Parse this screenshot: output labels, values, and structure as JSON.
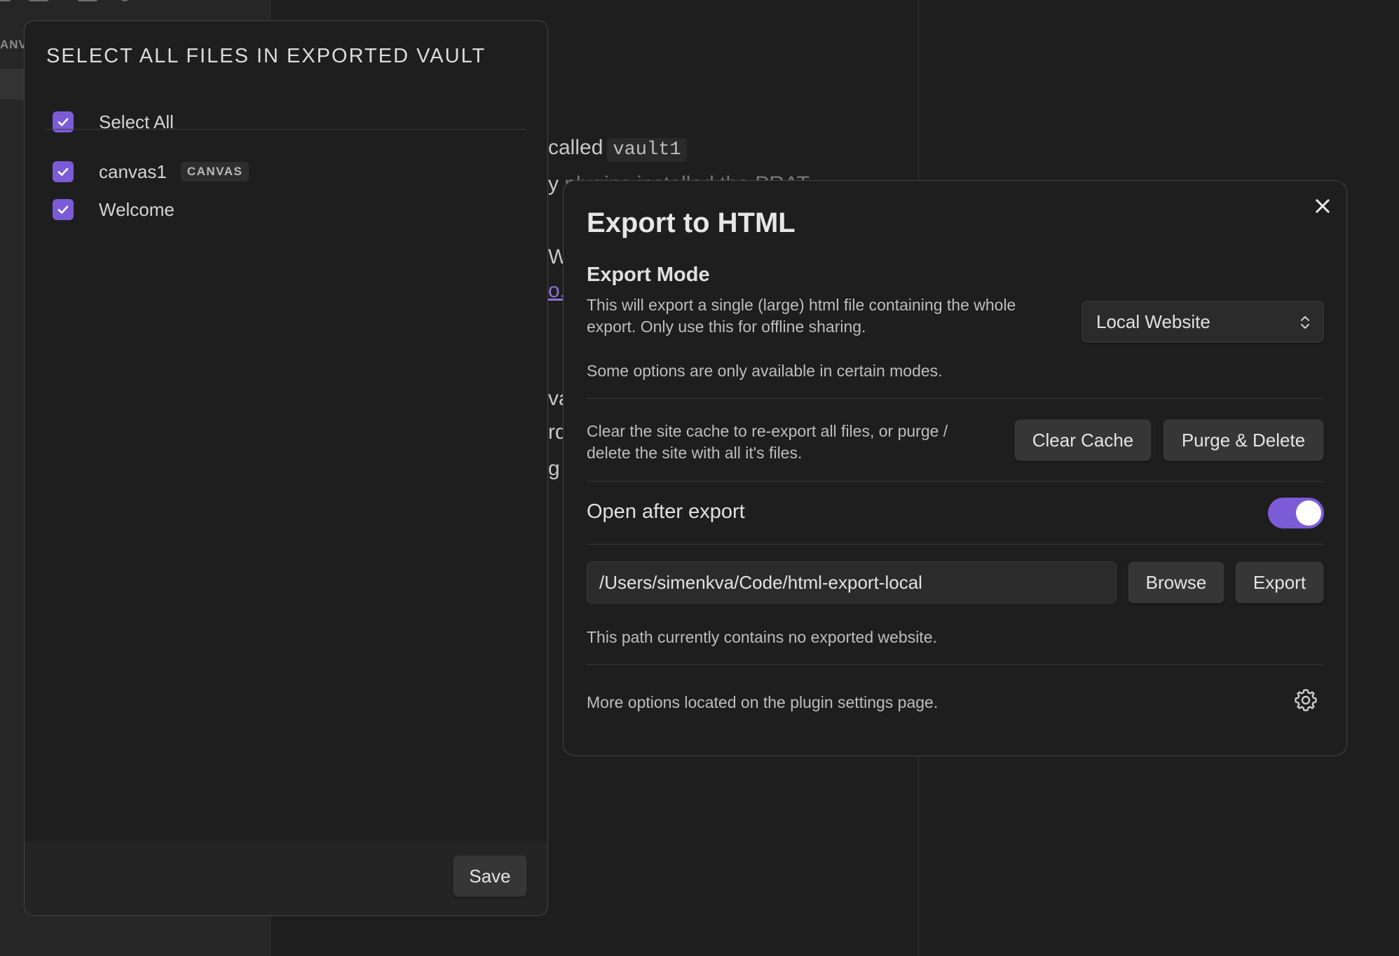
{
  "background": {
    "sidebar_label": "ANV",
    "line1_text": "called",
    "line1_code": "vault1",
    "line2_text": "y",
    "line2_fragment": "plugins installed the PRAT",
    "line3_text": "W",
    "line4_link": "o.",
    "line5_text": "va",
    "line6_text": "rd",
    "line7_text": "g"
  },
  "picker": {
    "title": "SELECT ALL FILES IN EXPORTED VAULT",
    "select_all_label": "Select All",
    "files": [
      {
        "name": "canvas1",
        "tag": "CANVAS",
        "checked": true
      },
      {
        "name": "Welcome",
        "tag": "",
        "checked": true
      }
    ],
    "save_label": "Save"
  },
  "export": {
    "title": "Export to HTML",
    "mode_heading": "Export Mode",
    "mode_desc_line1": "This will export a single (large) html file containing the whole",
    "mode_desc_line2": "export. Only use this for offline sharing.",
    "mode_selected": "Local Website",
    "modes_note": "Some options are only available in certain modes.",
    "cache_desc_line1": "Clear the site cache to re-export all files, or purge /",
    "cache_desc_line2": "delete the site with all it's files.",
    "clear_cache_label": "Clear Cache",
    "purge_label": "Purge & Delete",
    "open_after_label": "Open after export",
    "open_after_on": true,
    "path_value": "/Users/simenkva/Code/html-export-local",
    "browse_label": "Browse",
    "export_label": "Export",
    "path_status": "This path currently contains no exported website.",
    "more_options": "More options located on the plugin settings page."
  },
  "colors": {
    "accent": "#7c5bd6",
    "background": "#1e1e1e",
    "button": "#363636"
  }
}
